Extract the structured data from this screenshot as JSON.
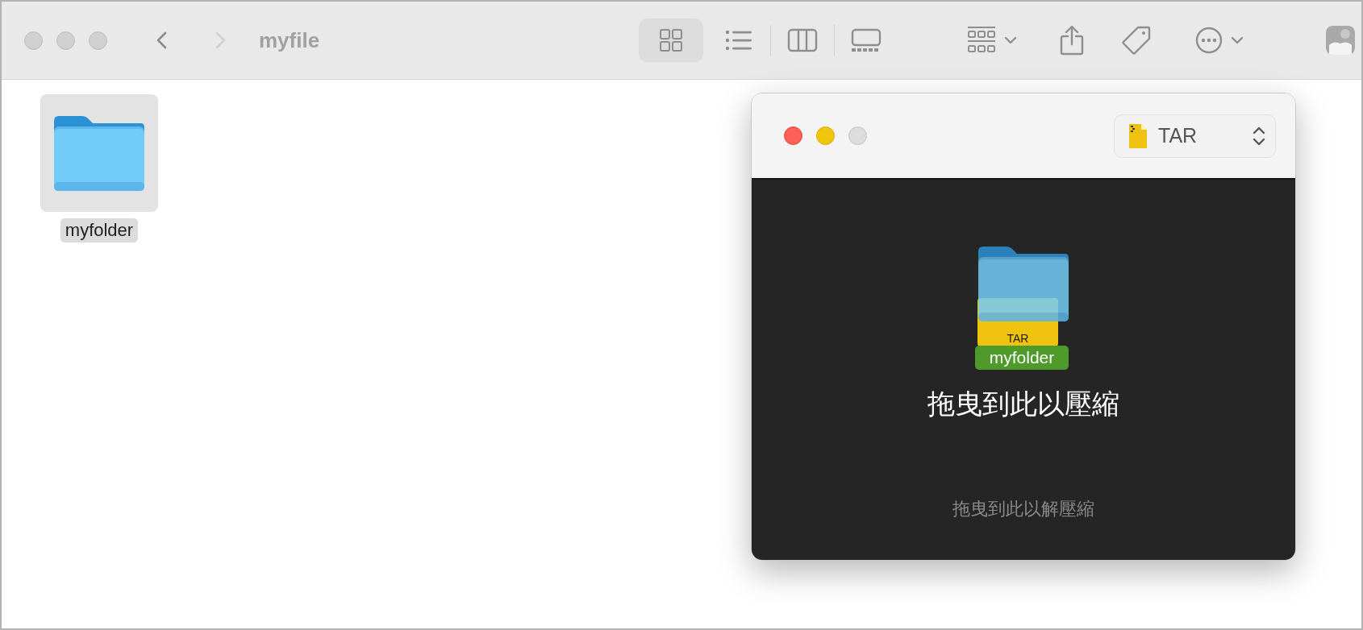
{
  "finder": {
    "navigation": [
      {
        "kind": "back",
        "disabled": false
      },
      {
        "kind": "forward",
        "disabled": true
      }
    ],
    "title": "myfile",
    "view_modes": [
      {
        "kind": "icons",
        "selected": true
      },
      {
        "kind": "list",
        "selected": false
      },
      {
        "kind": "columns",
        "selected": false
      },
      {
        "kind": "gallery",
        "selected": false
      }
    ],
    "items": [
      {
        "name": "myfolder",
        "selected": true
      }
    ]
  },
  "archiver": {
    "format": "TAR",
    "drag_preview": {
      "name": "myfolder",
      "file_label": "TAR"
    },
    "compress_hint": "拖曳到此以壓縮",
    "extract_hint": "拖曳到此以解壓縮"
  }
}
